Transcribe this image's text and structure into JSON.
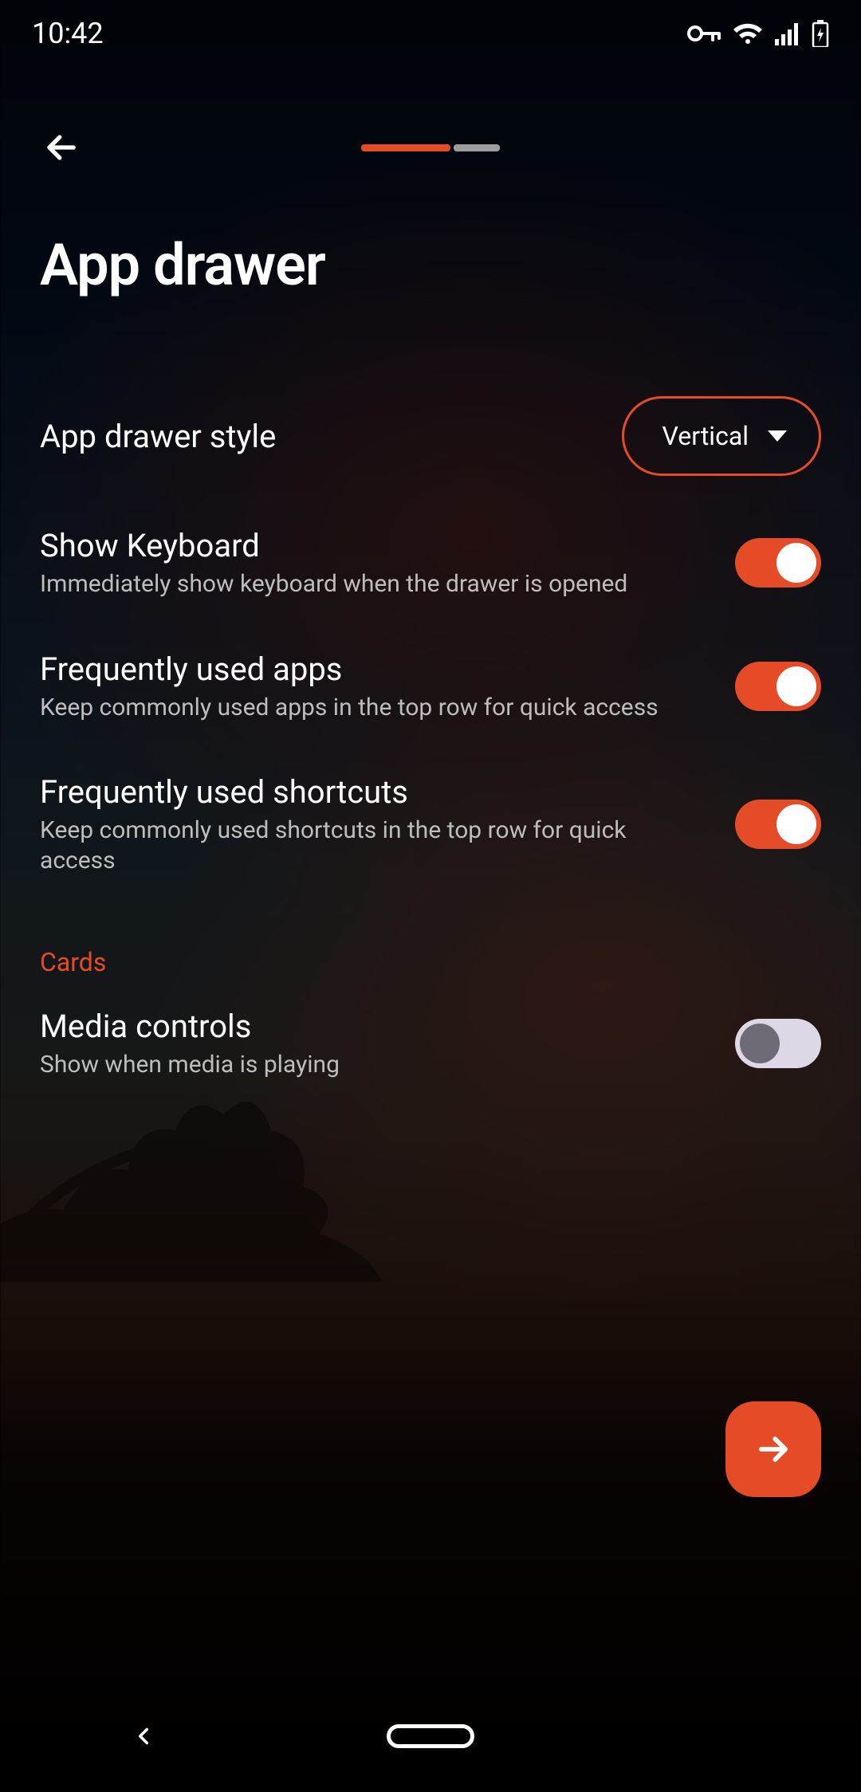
{
  "status": {
    "time": "10:42"
  },
  "page": {
    "title": "App drawer"
  },
  "settings": {
    "style": {
      "label": "App drawer style",
      "value": "Vertical"
    },
    "showKeyboard": {
      "title": "Show Keyboard",
      "sub": "Immediately show keyboard when the drawer is opened",
      "on": true
    },
    "freqApps": {
      "title": "Frequently used apps",
      "sub": "Keep commonly used apps in the top row for quick access",
      "on": true
    },
    "freqShortcuts": {
      "title": "Frequently used shortcuts",
      "sub": "Keep commonly used shortcuts in the top row for quick access",
      "on": true
    }
  },
  "sections": {
    "cards": "Cards"
  },
  "cards": {
    "media": {
      "title": "Media controls",
      "sub": "Show when media is playing",
      "on": false
    }
  }
}
